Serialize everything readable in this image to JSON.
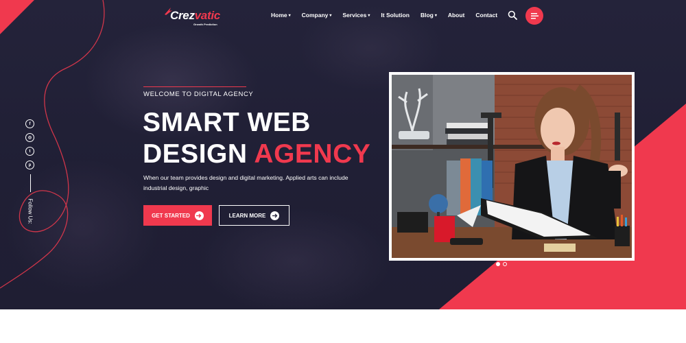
{
  "brand": {
    "name_part1": "Crez",
    "name_part2": "vatic",
    "tagline": "Growth Prediction"
  },
  "nav": {
    "items": [
      {
        "label": "Home",
        "dropdown": true
      },
      {
        "label": "Company",
        "dropdown": true
      },
      {
        "label": "Services",
        "dropdown": true
      },
      {
        "label": "It Solution",
        "dropdown": false
      },
      {
        "label": "Blog",
        "dropdown": true
      },
      {
        "label": "About",
        "dropdown": false
      },
      {
        "label": "Contact",
        "dropdown": false
      }
    ]
  },
  "social": {
    "icons": [
      "facebook-icon",
      "instagram-icon",
      "twitter-icon",
      "pinterest-icon"
    ],
    "glyphs": [
      "f",
      "◎",
      "t",
      "p"
    ],
    "follow_label": "Follow Us:"
  },
  "hero": {
    "welcome": "WELCOME TO DIGITAL AGENCY",
    "headline_line1": "SMART WEB",
    "headline_line2_white": "DESIGN",
    "headline_line2_accent": "AGENCY",
    "description": "When our team provides design and digital marketing. Applied arts can include industrial design, graphic",
    "primary_button": "GET STARTED",
    "secondary_button": "LEARN MORE"
  },
  "slider": {
    "slide_count": 2,
    "active_slide": 1
  },
  "colors": {
    "accent": "#f0394e",
    "background": "#24233a",
    "text": "#ffffff"
  }
}
